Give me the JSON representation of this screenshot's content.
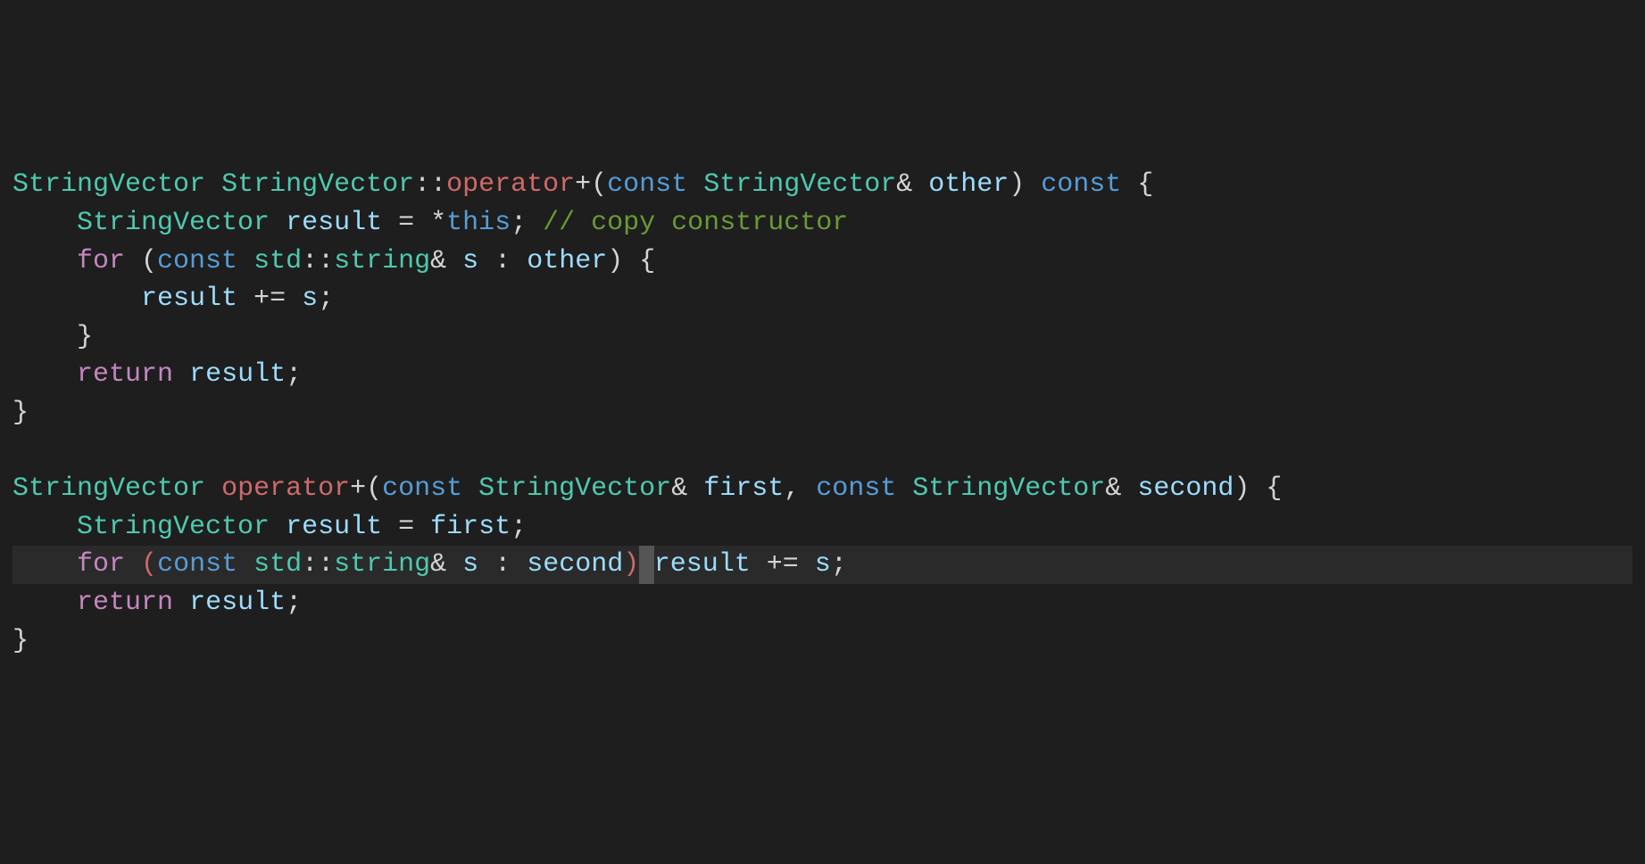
{
  "code": {
    "lines": [
      {
        "indent": "",
        "tokens": [
          {
            "t": "StringVector",
            "c": "type"
          },
          {
            "t": " ",
            "c": "punct"
          },
          {
            "t": "StringVector",
            "c": "type"
          },
          {
            "t": "::",
            "c": "punct"
          },
          {
            "t": "operator",
            "c": "operator-word"
          },
          {
            "t": "+(",
            "c": "punct"
          },
          {
            "t": "const",
            "c": "keyword-blue"
          },
          {
            "t": " ",
            "c": "punct"
          },
          {
            "t": "StringVector",
            "c": "type"
          },
          {
            "t": "& ",
            "c": "punct"
          },
          {
            "t": "other",
            "c": "variable"
          },
          {
            "t": ") ",
            "c": "punct"
          },
          {
            "t": "const",
            "c": "keyword-blue"
          },
          {
            "t": " {",
            "c": "punct"
          }
        ],
        "hl": false
      },
      {
        "indent": "    ",
        "tokens": [
          {
            "t": "StringVector",
            "c": "type"
          },
          {
            "t": " ",
            "c": "punct"
          },
          {
            "t": "result",
            "c": "variable"
          },
          {
            "t": " = *",
            "c": "punct"
          },
          {
            "t": "this",
            "c": "keyword-blue"
          },
          {
            "t": "; ",
            "c": "punct"
          },
          {
            "t": "// copy constructor",
            "c": "comment"
          }
        ],
        "hl": false
      },
      {
        "indent": "    ",
        "tokens": [
          {
            "t": "for",
            "c": "keyword-pink"
          },
          {
            "t": " (",
            "c": "punct"
          },
          {
            "t": "const",
            "c": "keyword-blue"
          },
          {
            "t": " ",
            "c": "punct"
          },
          {
            "t": "std",
            "c": "type"
          },
          {
            "t": "::",
            "c": "punct"
          },
          {
            "t": "string",
            "c": "type"
          },
          {
            "t": "& ",
            "c": "punct"
          },
          {
            "t": "s",
            "c": "variable"
          },
          {
            "t": " : ",
            "c": "punct"
          },
          {
            "t": "other",
            "c": "variable"
          },
          {
            "t": ") {",
            "c": "punct"
          }
        ],
        "hl": false
      },
      {
        "indent": "        ",
        "tokens": [
          {
            "t": "result",
            "c": "variable"
          },
          {
            "t": " += ",
            "c": "punct"
          },
          {
            "t": "s",
            "c": "variable"
          },
          {
            "t": ";",
            "c": "punct"
          }
        ],
        "hl": false
      },
      {
        "indent": "    ",
        "tokens": [
          {
            "t": "}",
            "c": "punct"
          }
        ],
        "hl": false
      },
      {
        "indent": "    ",
        "tokens": [
          {
            "t": "return",
            "c": "keyword-pink"
          },
          {
            "t": " ",
            "c": "punct"
          },
          {
            "t": "result",
            "c": "variable"
          },
          {
            "t": ";",
            "c": "punct"
          }
        ],
        "hl": false
      },
      {
        "indent": "",
        "tokens": [
          {
            "t": "}",
            "c": "punct"
          }
        ],
        "hl": false
      },
      {
        "indent": "",
        "tokens": [],
        "hl": false
      },
      {
        "indent": "",
        "tokens": [
          {
            "t": "StringVector",
            "c": "type"
          },
          {
            "t": " ",
            "c": "punct"
          },
          {
            "t": "operator",
            "c": "operator-word"
          },
          {
            "t": "+(",
            "c": "punct"
          },
          {
            "t": "const",
            "c": "keyword-blue"
          },
          {
            "t": " ",
            "c": "punct"
          },
          {
            "t": "StringVector",
            "c": "type"
          },
          {
            "t": "& ",
            "c": "punct"
          },
          {
            "t": "first",
            "c": "variable"
          },
          {
            "t": ", ",
            "c": "punct"
          },
          {
            "t": "const",
            "c": "keyword-blue"
          },
          {
            "t": " ",
            "c": "punct"
          },
          {
            "t": "StringVector",
            "c": "type"
          },
          {
            "t": "& ",
            "c": "punct"
          },
          {
            "t": "second",
            "c": "variable"
          },
          {
            "t": ") {",
            "c": "punct"
          }
        ],
        "hl": false
      },
      {
        "indent": "    ",
        "tokens": [
          {
            "t": "StringVector",
            "c": "type"
          },
          {
            "t": " ",
            "c": "punct"
          },
          {
            "t": "result",
            "c": "variable"
          },
          {
            "t": " = ",
            "c": "punct"
          },
          {
            "t": "first",
            "c": "variable"
          },
          {
            "t": ";",
            "c": "punct"
          }
        ],
        "hl": false
      },
      {
        "indent": "    ",
        "tokens": [
          {
            "t": "for",
            "c": "keyword-pink"
          },
          {
            "t": " ",
            "c": "punct"
          },
          {
            "t": "(",
            "c": "paren-match"
          },
          {
            "t": "const",
            "c": "keyword-blue"
          },
          {
            "t": " ",
            "c": "punct"
          },
          {
            "t": "std",
            "c": "type"
          },
          {
            "t": "::",
            "c": "punct"
          },
          {
            "t": "string",
            "c": "type"
          },
          {
            "t": "& ",
            "c": "punct"
          },
          {
            "t": "s",
            "c": "variable"
          },
          {
            "t": " : ",
            "c": "punct"
          },
          {
            "t": "second",
            "c": "variable"
          },
          {
            "t": ")",
            "c": "paren-match"
          },
          {
            "t": " ",
            "c": "caret-block"
          },
          {
            "t": "result",
            "c": "variable"
          },
          {
            "t": " += ",
            "c": "punct"
          },
          {
            "t": "s",
            "c": "variable"
          },
          {
            "t": ";",
            "c": "punct"
          }
        ],
        "hl": true
      },
      {
        "indent": "    ",
        "tokens": [
          {
            "t": "return",
            "c": "keyword-pink"
          },
          {
            "t": " ",
            "c": "punct"
          },
          {
            "t": "result",
            "c": "variable"
          },
          {
            "t": ";",
            "c": "punct"
          }
        ],
        "hl": false
      },
      {
        "indent": "",
        "tokens": [
          {
            "t": "}",
            "c": "punct"
          }
        ],
        "hl": false
      }
    ]
  }
}
